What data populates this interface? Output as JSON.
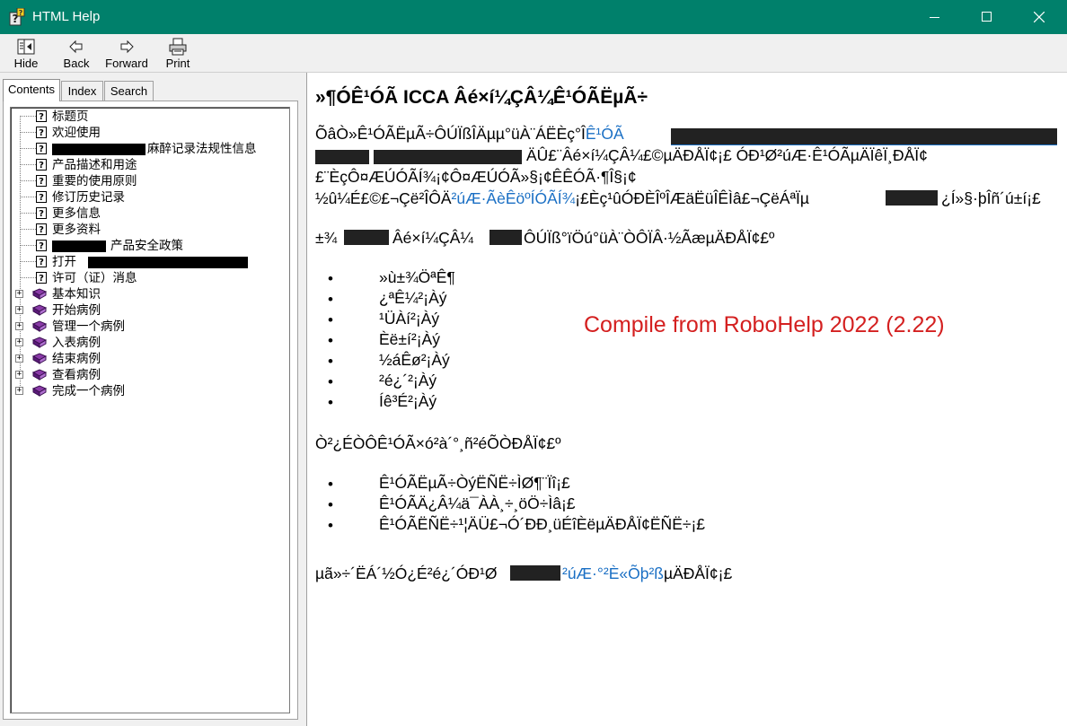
{
  "window": {
    "title": "HTML Help"
  },
  "toolbar": {
    "hide": "Hide",
    "back": "Back",
    "forward": "Forward",
    "print": "Print"
  },
  "tabs": {
    "contents": "Contents",
    "index": "Index",
    "search": "Search"
  },
  "toc": {
    "topics": [
      {
        "label": "标题页"
      },
      {
        "label": "欢迎使用"
      },
      {
        "label": "麻醉记录法规性信息"
      },
      {
        "label": "产品描述和用途"
      },
      {
        "label": "重要的使用原则"
      },
      {
        "label": "修订历史记录"
      },
      {
        "label": "更多信息"
      },
      {
        "label": "更多资料"
      },
      {
        "label": "产品安全政策"
      },
      {
        "label": "打开"
      },
      {
        "label": "许可（证）消息"
      }
    ],
    "books": [
      {
        "label": "基本知识"
      },
      {
        "label": "开始病例"
      },
      {
        "label": "管理一个病例"
      },
      {
        "label": "入表病例"
      },
      {
        "label": "结束病例"
      },
      {
        "label": "查看病例"
      },
      {
        "label": "完成一个病例"
      }
    ]
  },
  "content": {
    "heading": "»¶ÓÊ¹ÓÃ ICCA Âé×í¼ÇÂ¼Ê¹ÓÃËµÃ÷",
    "p1_line1": "ÕâÒ»Ê¹ÓÃËµÃ÷ÔÚÏßÎÄµµ°üÀ¨ÁËÈç°Î",
    "p1_line1_link": "Ê¹ÓÃ",
    "p1_line2": "ÄÛ£¨Âé×í¼ÇÂ¼£©µÄÐÅÏ¢¡£  ÓÐ¹Ø²úÆ·Ê¹ÓÃµÄÏêÏ¸ÐÅÏ¢",
    "p1_line3": "£¨ÈçÔ¤ÆÚÓÃÍ¾¡¢Ô¤ÆÚÓÃ»§¡¢ÊÊÓÃ·¶Î§¡¢",
    "p1_line4_pre": "½û¼É£©£¬Çë²ÎÔÄ",
    "p1_line4_link": "²úÆ·ÃèÊöºÍÓÃÍ¾",
    "p1_line4_post": "¡£Èç¹ûÓÐÈÎºÎÆäËüÎÊÌâ£¬ÇëÁªÏµ",
    "p1_line4_tail": "¿Í»§·þÎñ´ú±í¡£",
    "p2_pre": "±¾",
    "p2_mid": "Âé×í¼ÇÂ¼",
    "p2_post": "ÔÚÏß°ïÖú°üÀ¨ÒÔÏÂ·½ÃæµÄÐÅÏ¢£º",
    "list1": [
      "»ù±¾ÖªÊ¶",
      "¿ªÊ¼²¡Àý",
      "¹ÜÀí²¡Àý",
      "Èë±í²¡Àý",
      "½áÊø²¡Àý",
      "²é¿´²¡Àý",
      "Íê³É²¡Àý"
    ],
    "p3": "Ò²¿ÉÒÔÊ¹ÓÃ×ó²à´°¸ñ²éÕÒÐÅÏ¢£º",
    "list2": [
      "Ê¹ÓÃËµÃ÷ÒýËÑË÷ÌØ¶¨Ïî¡£",
      "Ê¹ÓÃÄ¿Â¼ä¯ÀÀ¸÷¸öÖ÷Ìâ¡£",
      "Ê¹ÓÃËÑË÷¹¦ÄÜ£¬Ó´ÐÐ¸üÉîÈëµÄÐÅÏ¢ËÑË÷¡£"
    ],
    "p4_pre": "µã»÷´ËÁ´½Ó¿É²é¿´ÓÐ¹Ø",
    "p4_link": "²úÆ·°²È«Õþ²ß",
    "p4_post": "µÄÐÅÏ¢¡£",
    "overlay": "Compile from RoboHelp 2022 (2.22)"
  }
}
